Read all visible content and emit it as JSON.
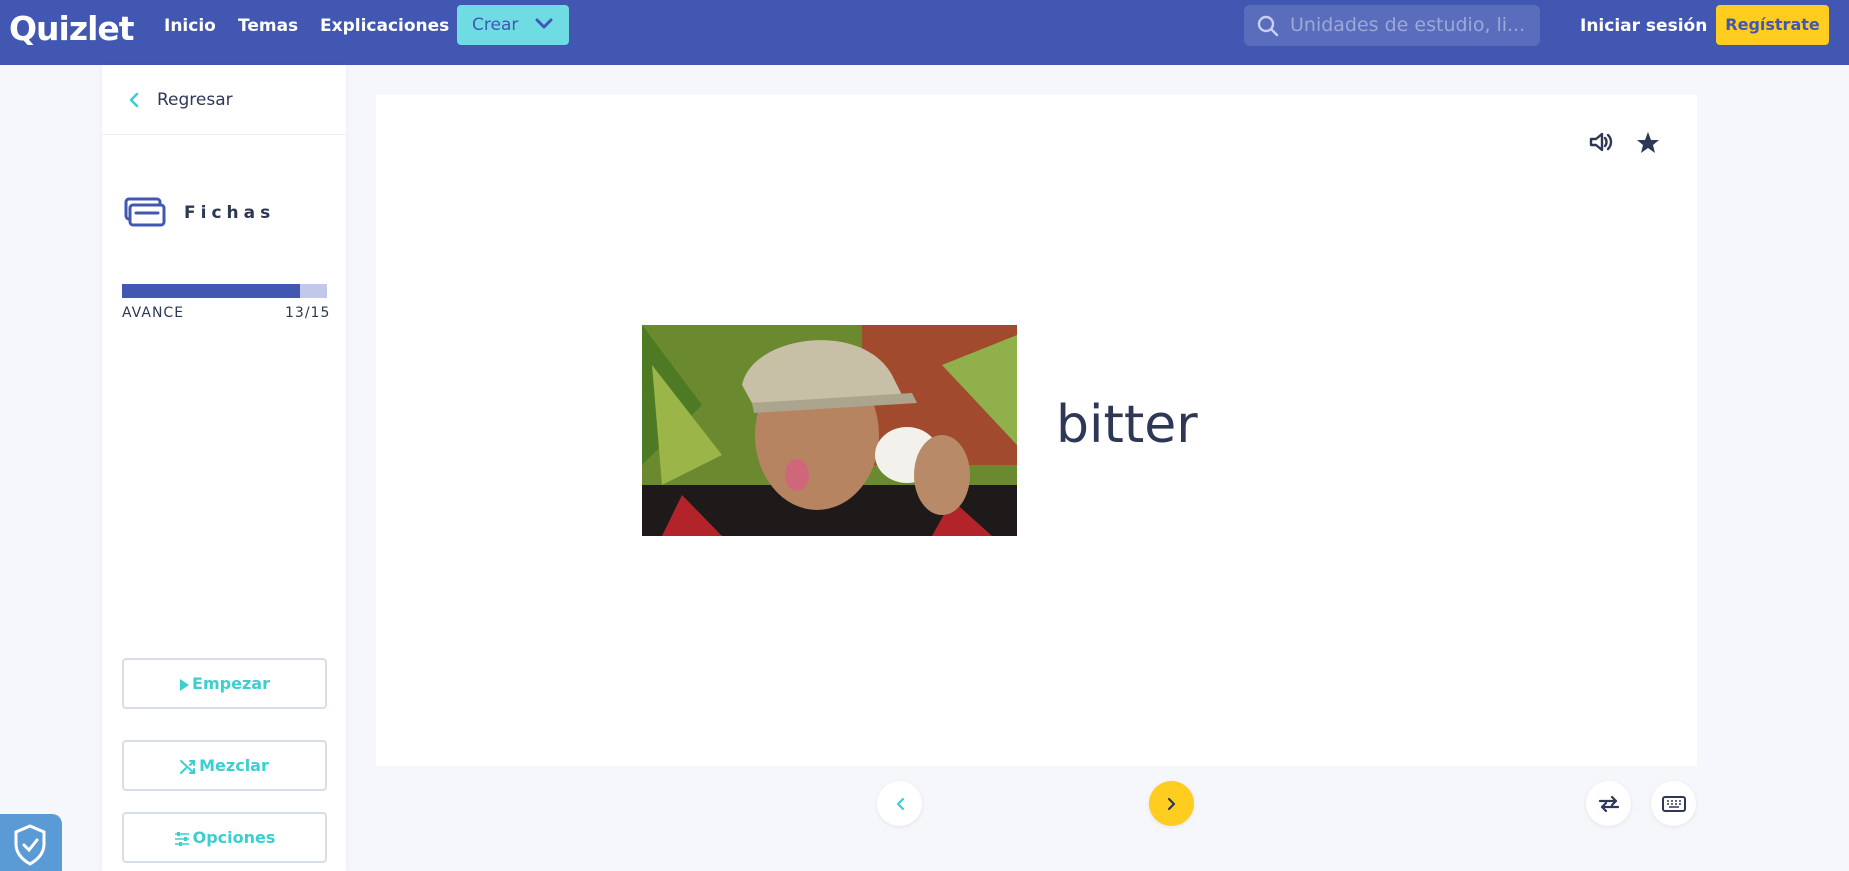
{
  "header": {
    "logo": "Quizlet",
    "nav": [
      "Inicio",
      "Temas",
      "Explicaciones"
    ],
    "create_label": "Crear",
    "search_placeholder": "Unidades de estudio, li...",
    "login_label": "Iniciar sesión",
    "signup_label": "Regístrate"
  },
  "sidebar": {
    "back_label": "Regresar",
    "mode_label": "Fichas",
    "progress_label": "AVANCE",
    "progress_count": "13/15",
    "progress_fraction": 0.867,
    "start_label": "Empezar",
    "shuffle_label": "Mezclar",
    "options_label": "Opciones"
  },
  "card": {
    "term": "bitter",
    "image_description": "man-tasting-bitter-drink"
  },
  "colors": {
    "brand": "#4257b2",
    "accent": "#3ccfcf",
    "yellow": "#ffcd1f"
  }
}
